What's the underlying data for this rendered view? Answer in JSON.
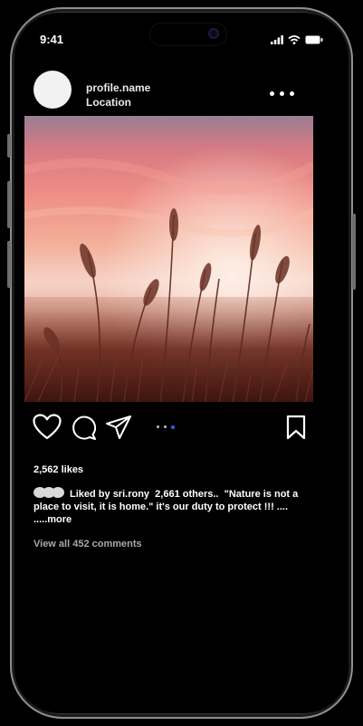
{
  "status_bar": {
    "time": "9:41"
  },
  "post": {
    "profile_name": "profile.name",
    "location": "Location",
    "likes": "2,562 likes",
    "caption": {
      "liked_by_prefix": "Liked  by ",
      "liked_by_user": "sri.rony",
      "others": "2,661 others..",
      "text": "\"Nature is not a place to visit, it is home.\" it's our duty to protect !!! ....",
      "more": ".....more"
    },
    "view_comments": "View all 452 comments"
  },
  "colors": {
    "background": "#000000",
    "text": "#ffffff",
    "muted": "#a8a8a8",
    "carousel_active": "#3b5bdb"
  },
  "icons": [
    "heart-icon",
    "comment-icon",
    "share-icon",
    "bookmark-icon",
    "more-options-icon"
  ]
}
